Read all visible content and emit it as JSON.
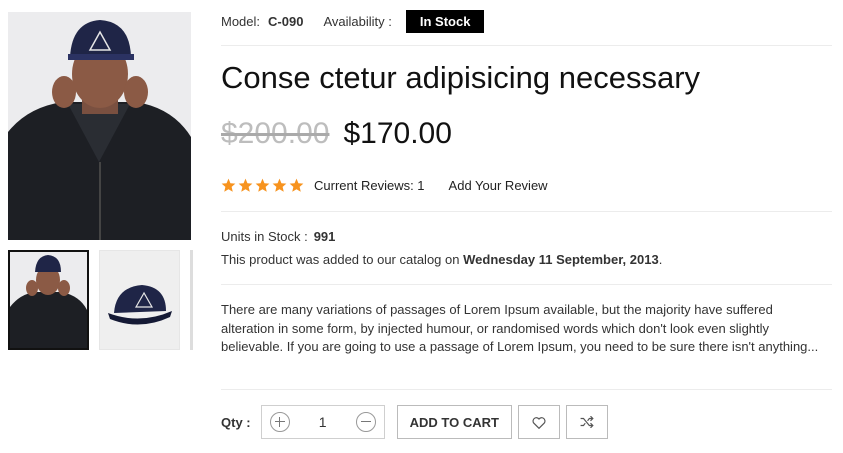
{
  "product": {
    "model_label": "Model:",
    "model_value": "C-090",
    "availability_label": "Availability :",
    "availability_value": "In Stock",
    "title": "Conse ctetur adipisicing necessary",
    "old_price": "$200.00",
    "new_price": "$170.00",
    "rating_stars": 5,
    "reviews_text": "Current Reviews: 1",
    "add_review": "Add Your Review",
    "units_label": "Units in Stock :",
    "units_value": "991",
    "added_prefix": "This product was added to our catalog on",
    "added_date": "Wednesday 11 September, 2013",
    "added_suffix": ".",
    "description": "There are many variations of passages of Lorem Ipsum available, but the majority have suffered alteration in some form, by injected humour, or randomised words which don't look even slightly believable. If you are going to use a passage of Lorem Ipsum, you need to be sure there isn't anything..."
  },
  "purchase": {
    "qty_label": "Qty :",
    "qty_value": "1",
    "add_to_cart": "ADD TO CART"
  },
  "icons": {
    "star": "star-icon",
    "wishlist": "heart-icon",
    "compare": "shuffle-icon",
    "increase": "plus-icon",
    "decrease": "minus-icon"
  },
  "colors": {
    "badge_bg": "#000000",
    "star": "#f7931e",
    "old_price": "#bdbdbd"
  }
}
